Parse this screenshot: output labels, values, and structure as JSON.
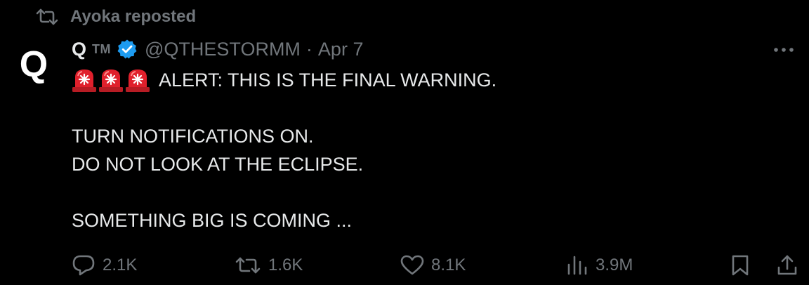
{
  "repost": {
    "icon": "repost-icon",
    "text": "Ayoka reposted"
  },
  "author": {
    "avatar_letter": "Q",
    "name": "Q",
    "tm": "TM",
    "verified_icon": "verified-badge-icon",
    "handle": "@QTHESTORMM",
    "separator": "·",
    "date": "Apr 7"
  },
  "more_icon": "more-options-icon",
  "tweet": {
    "siren_icon": "police-siren-emoji",
    "siren_count": 3,
    "line1": "ALERT: THIS IS THE FINAL WARNING.",
    "line2": "TURN NOTIFICATIONS ON.",
    "line3": "DO NOT LOOK AT THE ECLIPSE.",
    "line4": "SOMETHING BIG IS COMING ..."
  },
  "actions": {
    "replies": "2.1K",
    "reposts": "1.6K",
    "likes": "8.1K",
    "views": "3.9M"
  },
  "colors": {
    "background": "#000000",
    "text": "#e7e9ea",
    "muted": "#71767b",
    "verified": "#1d9bf0",
    "siren_red": "#e0202c"
  }
}
